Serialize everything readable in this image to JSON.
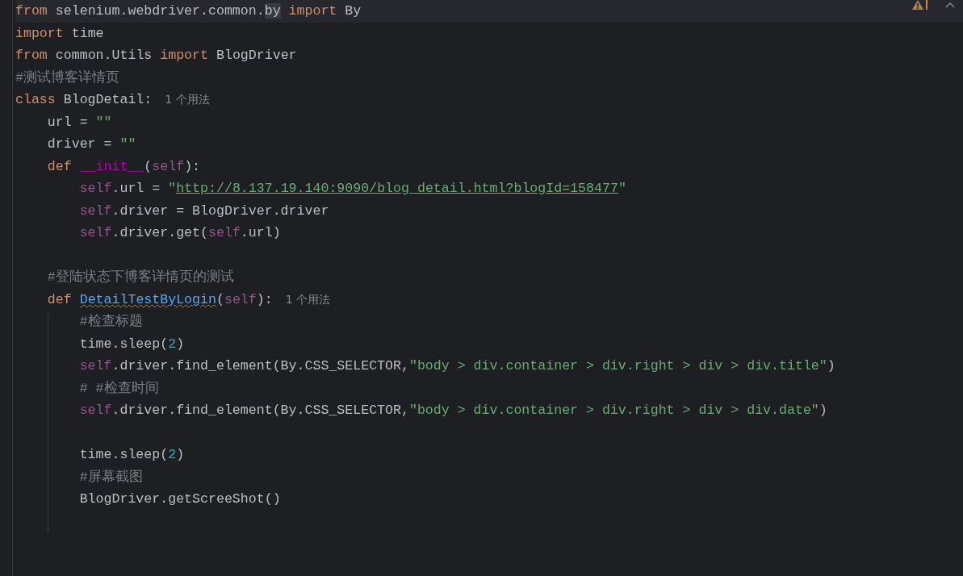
{
  "editor": {
    "lines": [
      {
        "current": true,
        "tokens": [
          {
            "kind": "kw",
            "text": "from "
          },
          {
            "kind": "plain",
            "text": "selenium.webdriver.common."
          },
          {
            "kind": "match",
            "text": "by"
          },
          {
            "kind": "kw",
            "text": " import "
          },
          {
            "kind": "plain",
            "text": "By"
          }
        ]
      },
      {
        "tokens": [
          {
            "kind": "kw",
            "text": "import "
          },
          {
            "kind": "plain",
            "text": "time"
          }
        ]
      },
      {
        "tokens": [
          {
            "kind": "kw",
            "text": "from "
          },
          {
            "kind": "plain",
            "text": "common.Utils "
          },
          {
            "kind": "kw",
            "text": "import "
          },
          {
            "kind": "plain",
            "text": "BlogDriver"
          }
        ]
      },
      {
        "tokens": [
          {
            "kind": "comment",
            "text": "#测试博客详情页"
          }
        ]
      },
      {
        "tokens": [
          {
            "kind": "kw",
            "text": "class "
          },
          {
            "kind": "plain",
            "text": "BlogDetail:"
          },
          {
            "kind": "hint",
            "text": "1 个用法"
          }
        ]
      },
      {
        "tokens": [
          {
            "kind": "plain",
            "text": "    url = "
          },
          {
            "kind": "string",
            "text": "\"\""
          }
        ]
      },
      {
        "tokens": [
          {
            "kind": "plain",
            "text": "    driver = "
          },
          {
            "kind": "string",
            "text": "\"\""
          }
        ]
      },
      {
        "tokens": [
          {
            "kind": "kw",
            "text": "    def "
          },
          {
            "kind": "dunder",
            "text": "__init__"
          },
          {
            "kind": "plain",
            "text": "("
          },
          {
            "kind": "self",
            "text": "self"
          },
          {
            "kind": "plain",
            "text": "):"
          }
        ]
      },
      {
        "tokens": [
          {
            "kind": "self",
            "text": "        self"
          },
          {
            "kind": "plain",
            "text": ".url = "
          },
          {
            "kind": "string",
            "text": "\""
          },
          {
            "kind": "link",
            "text": "http://8.137.19.140:9090/blog_detail.html?blogId=158477"
          },
          {
            "kind": "string",
            "text": "\""
          }
        ]
      },
      {
        "tokens": [
          {
            "kind": "self",
            "text": "        self"
          },
          {
            "kind": "plain",
            "text": ".driver = BlogDriver.driver"
          }
        ]
      },
      {
        "tokens": [
          {
            "kind": "self",
            "text": "        self"
          },
          {
            "kind": "plain",
            "text": ".driver.get("
          },
          {
            "kind": "self",
            "text": "self"
          },
          {
            "kind": "plain",
            "text": ".url)"
          }
        ]
      },
      {
        "gap_before": true,
        "tokens": [
          {
            "kind": "comment",
            "text": "    #登陆状态下博客详情页的测试"
          }
        ]
      },
      {
        "tokens": [
          {
            "kind": "kw",
            "text": "    def "
          },
          {
            "kind": "warnfn",
            "text": "DetailTestByLogin"
          },
          {
            "kind": "plain",
            "text": "("
          },
          {
            "kind": "self",
            "text": "self"
          },
          {
            "kind": "plain",
            "text": "):"
          },
          {
            "kind": "hint",
            "text": "1 个用法"
          }
        ]
      },
      {
        "guide": true,
        "tokens": [
          {
            "kind": "comment",
            "text": "        #检查标题"
          }
        ]
      },
      {
        "guide": true,
        "tokens": [
          {
            "kind": "plain",
            "text": "        time.sleep("
          },
          {
            "kind": "number",
            "text": "2"
          },
          {
            "kind": "plain",
            "text": ")"
          }
        ]
      },
      {
        "guide": true,
        "tokens": [
          {
            "kind": "self",
            "text": "        self"
          },
          {
            "kind": "plain",
            "text": ".driver.find_element(By.CSS_SELECTOR,"
          },
          {
            "kind": "string",
            "text": "\"body > div.container > div.right > div > div.title\""
          },
          {
            "kind": "plain",
            "text": ")"
          }
        ]
      },
      {
        "guide": true,
        "tokens": [
          {
            "kind": "comment",
            "text": "        # #检查时间"
          }
        ]
      },
      {
        "guide": true,
        "tokens": [
          {
            "kind": "self",
            "text": "        self"
          },
          {
            "kind": "plain",
            "text": ".driver.find_element(By.CSS_SELECTOR,"
          },
          {
            "kind": "string",
            "text": "\"body > div.container > div.right > div > div.date\""
          },
          {
            "kind": "plain",
            "text": ")"
          }
        ]
      },
      {
        "guide": true
      },
      {
        "guide": true,
        "tokens": [
          {
            "kind": "plain",
            "text": "        time.sleep("
          },
          {
            "kind": "number",
            "text": "2"
          },
          {
            "kind": "plain",
            "text": ")"
          }
        ]
      },
      {
        "guide": true,
        "tokens": [
          {
            "kind": "comment",
            "text": "        #屏幕截图"
          }
        ]
      },
      {
        "guide": true,
        "tokens": [
          {
            "kind": "plain",
            "text": "        BlogDriver.getScreeShot()"
          }
        ]
      },
      {
        "guide": true
      }
    ]
  }
}
